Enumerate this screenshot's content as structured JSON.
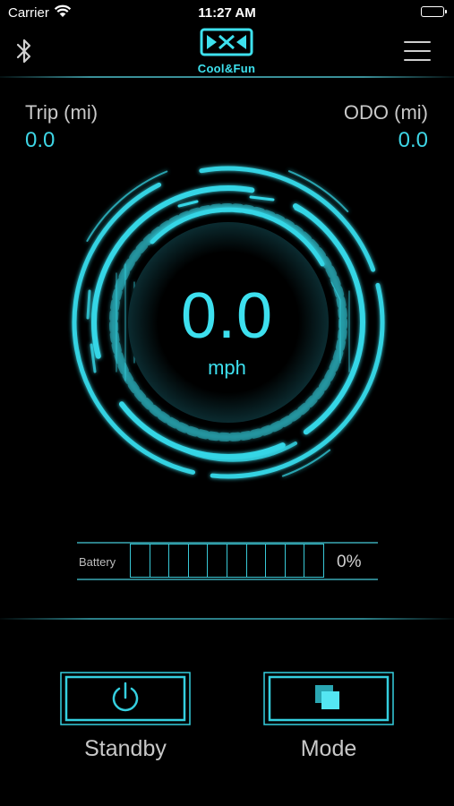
{
  "status_bar": {
    "carrier": "Carrier",
    "time": "11:27 AM"
  },
  "header": {
    "logo_text": "Cool&Fun"
  },
  "trip": {
    "label": "Trip (mi)",
    "value": "0.0"
  },
  "odo": {
    "label": "ODO (mi)",
    "value": "0.0"
  },
  "speed": {
    "value": "0.0",
    "unit": "mph"
  },
  "battery": {
    "label": "Battery",
    "percent_text": "0%",
    "level": 0,
    "segments": 10
  },
  "buttons": {
    "standby_label": "Standby",
    "mode_label": "Mode"
  },
  "colors": {
    "accent": "#3de0ef",
    "background": "#000000"
  },
  "icons": [
    "wifi-icon",
    "bluetooth-icon",
    "menu-icon",
    "power-icon",
    "mode-squares-icon"
  ]
}
